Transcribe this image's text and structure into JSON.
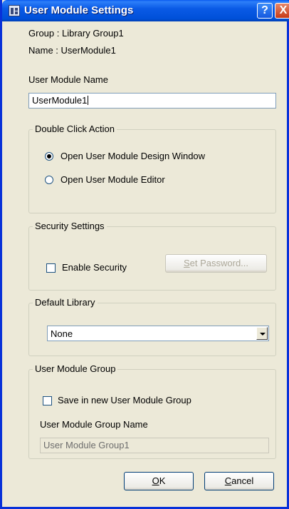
{
  "window": {
    "title": "User Module Settings",
    "help_glyph": "?",
    "close_glyph": "X"
  },
  "info": {
    "group": "Group : Library Group1",
    "name": "Name : UserModule1"
  },
  "module_name": {
    "label": "User Module Name",
    "value": "UserModule1"
  },
  "double_click": {
    "title": "Double Click Action",
    "options": [
      {
        "label": "Open User Module Design Window",
        "checked": true
      },
      {
        "label": "Open User Module Editor",
        "checked": false
      }
    ]
  },
  "security": {
    "title": "Security Settings",
    "enable_label": "Enable Security",
    "enable_checked": false,
    "set_password_mnemonic": "S",
    "set_password_rest": "et Password..."
  },
  "default_library": {
    "title": "Default Library",
    "selected": "None"
  },
  "module_group": {
    "title": "User Module Group",
    "save_new_label": "Save in new User Module Group",
    "save_new_checked": false,
    "group_name_label": "User Module Group Name",
    "group_name_value": "User Module Group1"
  },
  "buttons": {
    "ok_mnemonic": "O",
    "ok_rest": "K",
    "cancel_mnemonic": "C",
    "cancel_rest": "ancel"
  }
}
